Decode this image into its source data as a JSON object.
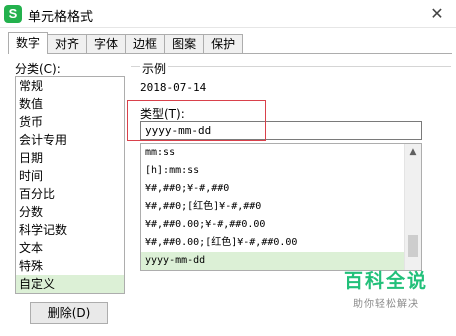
{
  "window": {
    "title": "单元格格式",
    "app_icon_letter": "S",
    "close_glyph": "✕"
  },
  "tabs": [
    {
      "label": "数字",
      "active": true
    },
    {
      "label": "对齐"
    },
    {
      "label": "字体"
    },
    {
      "label": "边框"
    },
    {
      "label": "图案"
    },
    {
      "label": "保护"
    }
  ],
  "category": {
    "label": "分类(C):",
    "items": [
      "常规",
      "数值",
      "货币",
      "会计专用",
      "日期",
      "时间",
      "百分比",
      "分数",
      "科学记数",
      "文本",
      "特殊",
      "自定义"
    ],
    "selected": "自定义"
  },
  "delete_button": "删除(D)",
  "sample": {
    "label": "示例",
    "value": "2018-07-14"
  },
  "type": {
    "label": "类型(T):",
    "value": "yyyy-mm-dd"
  },
  "format_list": {
    "items": [
      "mm:ss",
      "[h]:mm:ss",
      "¥#,##0;¥-#,##0",
      "¥#,##0;[红色]¥-#,##0",
      "¥#,##0.00;¥-#,##0.00",
      "¥#,##0.00;[红色]¥-#,##0.00",
      "yyyy-mm-dd"
    ],
    "selected": "yyyy-mm-dd"
  },
  "brand": {
    "title": "百科全说",
    "subtitle": "助你轻松解决"
  },
  "colors": {
    "accent": "#22c07a",
    "selection": "#dcf0d6",
    "highlight": "#d9414b",
    "app_icon": "#23b14d"
  }
}
